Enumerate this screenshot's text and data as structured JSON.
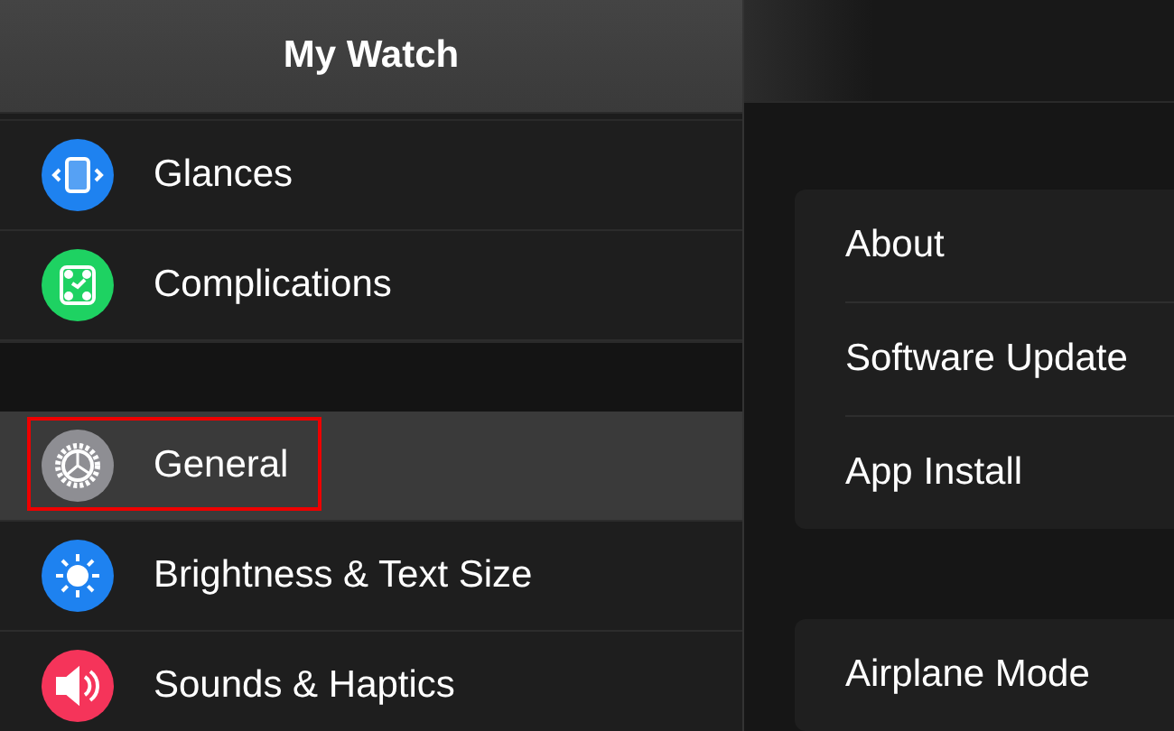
{
  "sidebar": {
    "title": "My Watch",
    "sections": [
      {
        "items": [
          {
            "label": "Glances",
            "kind": "glances",
            "selected": false,
            "highlighted": false
          },
          {
            "label": "Complications",
            "kind": "complications",
            "selected": false,
            "highlighted": false
          }
        ]
      },
      {
        "items": [
          {
            "label": "General",
            "kind": "general",
            "selected": true,
            "highlighted": true
          },
          {
            "label": "Brightness & Text Size",
            "kind": "brightness",
            "selected": false,
            "highlighted": false
          },
          {
            "label": "Sounds & Haptics",
            "kind": "sounds",
            "selected": false,
            "highlighted": false
          }
        ]
      }
    ]
  },
  "detail": {
    "groups": [
      {
        "items": [
          "About",
          "Software Update",
          "App Install"
        ]
      },
      {
        "items": [
          "Airplane Mode"
        ]
      }
    ]
  }
}
